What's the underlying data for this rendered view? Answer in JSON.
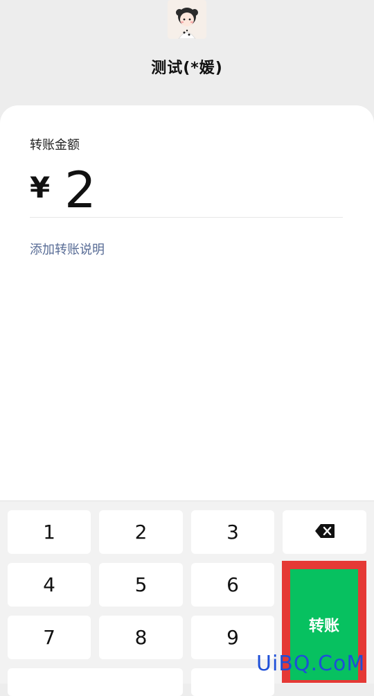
{
  "header": {
    "payee_name": "测试(*媛)"
  },
  "transfer_form": {
    "amount_label": "转账金额",
    "currency_symbol": "¥",
    "amount_value": "2",
    "add_note_link": "添加转账说明"
  },
  "keypad": {
    "keys": [
      "1",
      "2",
      "3",
      "4",
      "5",
      "6",
      "7",
      "8",
      "9"
    ],
    "delete_icon": "backspace-icon",
    "submit_label": "转账"
  },
  "watermark": "UiBQ.CoM",
  "colors": {
    "accent_green": "#07c160",
    "link_blue": "#576b95",
    "highlight_red": "#e53935"
  }
}
